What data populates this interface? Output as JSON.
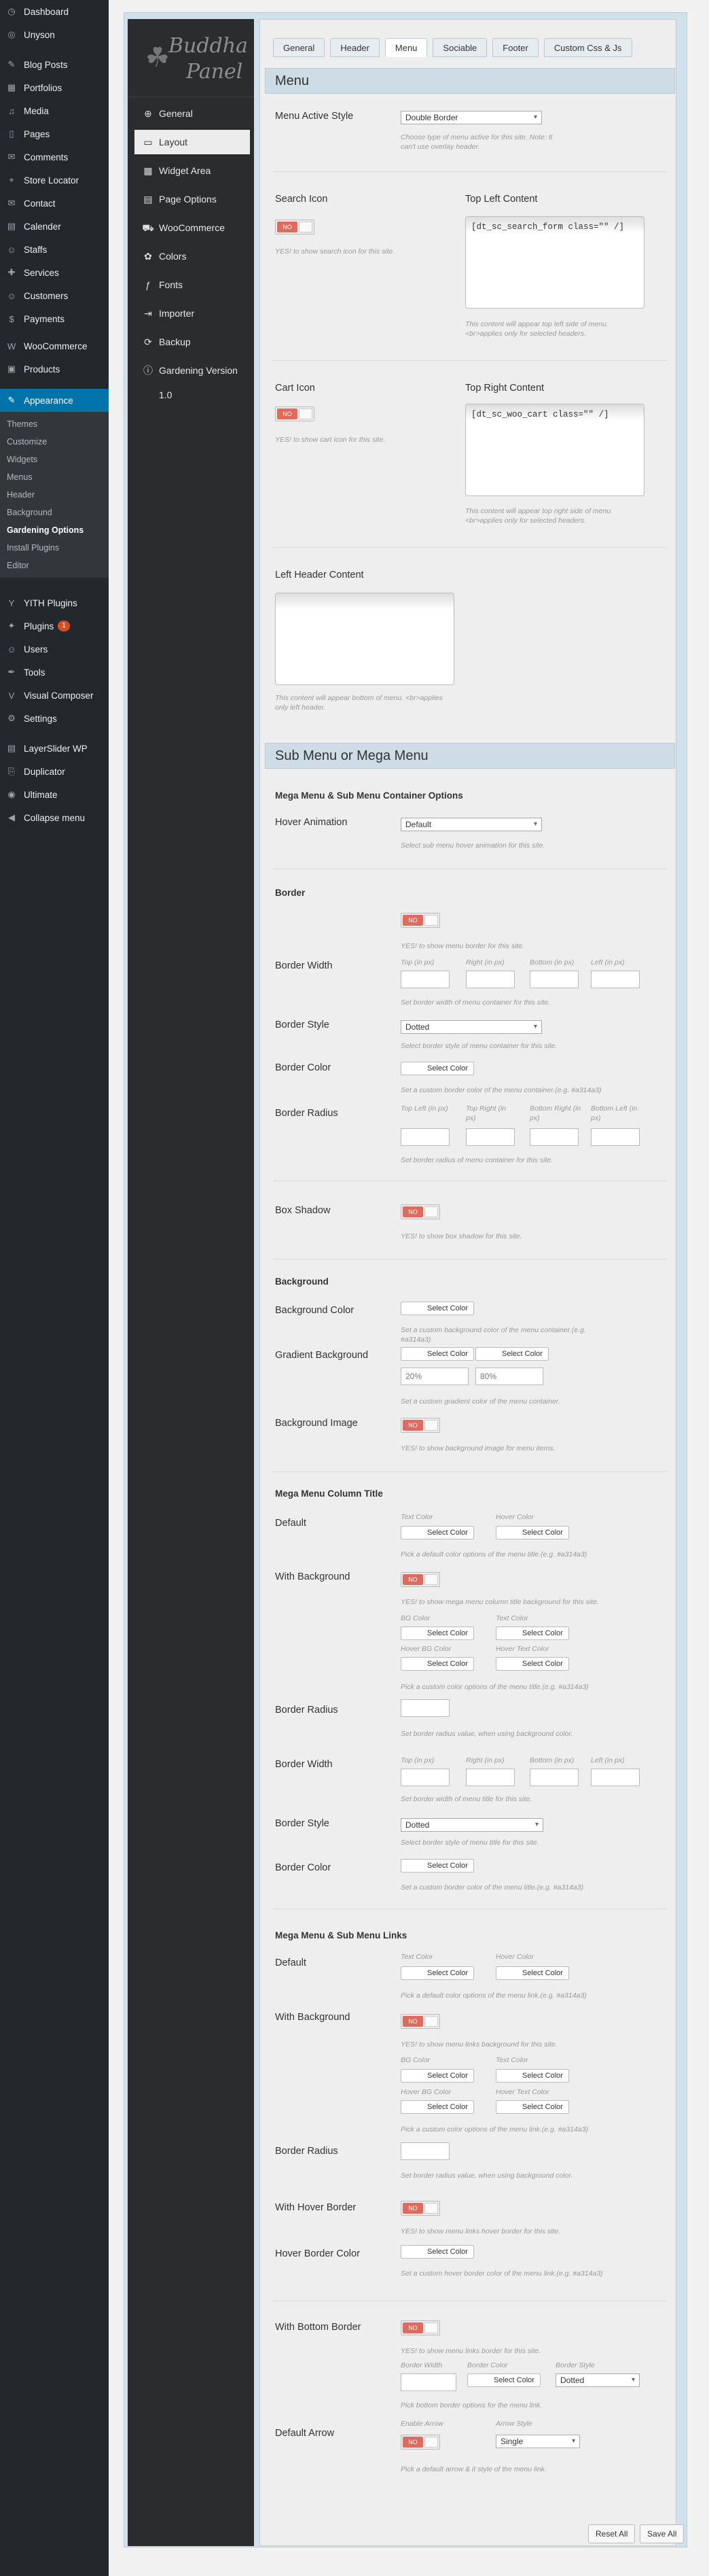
{
  "wp_menu": {
    "top": [
      {
        "icon": "dashboard-icon",
        "glyph": "◷",
        "label": "Dashboard"
      },
      {
        "icon": "wpml-icon",
        "glyph": "◎",
        "label": "Unyson"
      }
    ],
    "group2": [
      {
        "icon": "pin-icon",
        "glyph": "✎",
        "label": "Blog Posts"
      },
      {
        "icon": "portfolio-icon",
        "glyph": "▦",
        "label": "Portfolios"
      },
      {
        "icon": "media-icon",
        "glyph": "♫",
        "label": "Media"
      },
      {
        "icon": "pages-icon",
        "glyph": "▯",
        "label": "Pages"
      },
      {
        "icon": "comments-icon",
        "glyph": "✉",
        "label": "Comments"
      },
      {
        "icon": "location-icon",
        "glyph": "⌖",
        "label": "Store Locator"
      },
      {
        "icon": "contact-icon",
        "glyph": "✉",
        "label": "Contact"
      },
      {
        "icon": "calendar-icon",
        "glyph": "▤",
        "label": "Calender"
      },
      {
        "icon": "staff-icon",
        "glyph": "☺",
        "label": "Staffs"
      },
      {
        "icon": "services-icon",
        "glyph": "✚",
        "label": "Services"
      },
      {
        "icon": "customers-icon",
        "glyph": "☺",
        "label": "Customers"
      },
      {
        "icon": "payments-icon",
        "glyph": "$",
        "label": "Payments"
      }
    ],
    "group3": [
      {
        "icon": "woo-icon",
        "glyph": "W",
        "label": "WooCommerce"
      },
      {
        "icon": "products-icon",
        "glyph": "▣",
        "label": "Products"
      }
    ],
    "appearance": {
      "icon": "brush-icon",
      "glyph": "✎",
      "label": "Appearance"
    },
    "appearance_sub": [
      "Themes",
      "Customize",
      "Widgets",
      "Menus",
      "Header",
      "Background",
      "Gardening Options",
      "Install Plugins",
      "Editor"
    ],
    "appearance_active": "Gardening Options",
    "group4": [
      {
        "icon": "yith-icon",
        "glyph": "Y",
        "label": "YITH Plugins"
      },
      {
        "icon": "plugins-icon",
        "glyph": "✦",
        "label": "Plugins",
        "badge": "1"
      },
      {
        "icon": "users-icon",
        "glyph": "☺",
        "label": "Users"
      },
      {
        "icon": "tools-icon",
        "glyph": "✒",
        "label": "Tools"
      },
      {
        "icon": "vc-icon",
        "glyph": "V",
        "label": "Visual Composer"
      },
      {
        "icon": "settings-icon",
        "glyph": "⚙",
        "label": "Settings"
      }
    ],
    "group5": [
      {
        "icon": "layerslider-icon",
        "glyph": "▤",
        "label": "LayerSlider WP"
      },
      {
        "icon": "duplicator-icon",
        "glyph": "⎘",
        "label": "Duplicator"
      },
      {
        "icon": "ultimate-icon",
        "glyph": "◉",
        "label": "Ultimate"
      },
      {
        "icon": "collapse-icon",
        "glyph": "◀",
        "label": "Collapse menu"
      }
    ]
  },
  "brand": {
    "line1": "Buddha",
    "line2": "Panel"
  },
  "panel_nav": [
    {
      "icon": "globe-icon",
      "glyph": "⊕",
      "label": "General"
    },
    {
      "icon": "layout-icon",
      "glyph": "▭",
      "label": "Layout",
      "active": true
    },
    {
      "icon": "widget-icon",
      "glyph": "▦",
      "label": "Widget Area"
    },
    {
      "icon": "page-icon",
      "glyph": "▤",
      "label": "Page Options"
    },
    {
      "icon": "cart-icon",
      "glyph": "⛟",
      "label": "WooCommerce"
    },
    {
      "icon": "palette-icon",
      "glyph": "✿",
      "label": "Colors"
    },
    {
      "icon": "font-icon",
      "glyph": "ƒ",
      "label": "Fonts"
    },
    {
      "icon": "import-icon",
      "glyph": "⇥",
      "label": "Importer"
    },
    {
      "icon": "backup-icon",
      "glyph": "⟳",
      "label": "Backup"
    },
    {
      "icon": "info-icon",
      "glyph": "ⓘ",
      "label": "Gardening Version 1.0"
    }
  ],
  "tabs": [
    "General",
    "Header",
    "Menu",
    "Sociable",
    "Footer",
    "Custom Css & Js"
  ],
  "active_tab": "Menu",
  "yes_no": "NO",
  "select_color": "Select Color",
  "menu": {
    "title": "Menu",
    "active_style_label": "Menu Active Style",
    "active_style_value": "Double Border",
    "active_style_hint": "Choose type of menu active for this site. Note: It can't use overlay header.",
    "search_label": "Search Icon",
    "search_hint": "YES! to show search icon for this site.",
    "top_left_label": "Top Left Content",
    "top_left_value": "[dt_sc_search_form class=\"\" /]",
    "top_left_hint": "This content will appear top left side of menu. <br>applies only for selected headers.",
    "cart_label": "Cart Icon",
    "cart_hint": "YES! to show cart icon for this site.",
    "top_right_label": "Top Right Content",
    "top_right_value": "[dt_sc_woo_cart class=\"\" /]",
    "top_right_hint": "This content will appear top right side of menu. <br>applies only for selected headers.",
    "left_header_label": "Left Header Content",
    "left_header_hint": "This content will appear bottom of menu. <br>applies only left header."
  },
  "sub": {
    "title": "Sub Menu or Mega Menu",
    "container_heading": "Mega Menu & Sub Menu Container Options",
    "hover_anim_label": "Hover Animation",
    "hover_anim_value": "Default",
    "hover_anim_hint": "Select sub menu hover animation for this site.",
    "border_heading": "Border",
    "border_toggle_hint": "YES! to show menu border for this site.",
    "border_width_label": "Border Width",
    "border_width_subs": [
      "Top (in px)",
      "Right (in px)",
      "Bottom (in px)",
      "Left (in px)"
    ],
    "border_width_hint": "Set border width of menu container for this site.",
    "border_style_label": "Border Style",
    "border_style_value": "Dotted",
    "border_style_hint": "Select border style of menu container for this site.",
    "border_color_label": "Border Color",
    "border_color_hint": "Set a custom border color of the menu container.(e.g. #a314a3)",
    "border_radius_label": "Border Radius",
    "border_radius_subs": [
      "Top Left (in px)",
      "Top Right (in px)",
      "Bottom Right (in px)",
      "Bottom Left (in px)"
    ],
    "border_radius_hint": "Set border radius of menu container for this site.",
    "box_shadow_label": "Box Shadow",
    "box_shadow_hint": "YES! to show box shadow for this site.",
    "bg_heading": "Background",
    "bg_color_label": "Background Color",
    "bg_color_hint": "Set a custom background color of the menu container.(e.g. #a314a3)",
    "gradient_label": "Gradient Background",
    "gradient_p1": "20%",
    "gradient_p2": "80%",
    "gradient_hint": "Set a custom gradient color of the menu container.",
    "bg_image_label": "Background Image",
    "bg_image_hint": "YES! to show background image for menu items.",
    "col_heading": "Mega Menu Column Title",
    "col_default_label": "Default",
    "text_color": "Text Color",
    "hover_color": "Hover Color",
    "col_default_hint": "Pick a default color options of the menu title.(e.g. #a314a3)",
    "col_with_bg_label": "With Background",
    "col_with_bg_hint": "YES! to show mega menu column title background for this site.",
    "bg_color_sub": "BG Color",
    "hover_bg_color": "Hover BG Color",
    "hover_text_color": "Hover Text Color",
    "col_custom_hint": "Pick a custom color options of the menu title.(e.g. #a314a3)",
    "col_radius_label": "Border Radius",
    "col_radius_hint": "Set border radius value, when using background color.",
    "col_bwidth_label": "Border Width",
    "col_bwidth_hint": "Set border width of menu title for this site.",
    "col_bstyle_label": "Border Style",
    "col_bstyle_value": "Dotted",
    "col_bstyle_hint": "Select border style of menu title for this site.",
    "col_bcolor_label": "Border Color",
    "col_bcolor_hint": "Set a custom border color of the menu title.(e.g. #a314a3)",
    "links_heading": "Mega Menu & Sub Menu Links",
    "links_default_label": "Default",
    "links_default_hint": "Pick a default color options of the menu link.(e.g. #a314a3)",
    "links_with_bg_label": "With Background",
    "links_with_bg_hint": "YES! to show menu links background for this site.",
    "links_custom_hint": "Pick a custom color options of the menu link.(e.g. #a314a3)",
    "links_radius_label": "Border Radius",
    "links_radius_hint": "Set border radius value, when using background color.",
    "links_hover_border_label": "With Hover Border",
    "links_hover_border_hint": "YES! to show menu links hover border for this site.",
    "links_hover_bcolor_label": "Hover Border Color",
    "links_hover_bcolor_hint": "Set a custom hover border color of the menu link.(e.g. #a314a3)",
    "links_bottom_border_label": "With Bottom Border",
    "links_bottom_border_hint": "YES! to show menu links border for this site.",
    "bb_width": "Border Width",
    "bb_color": "Border Color",
    "bb_style": "Border Style",
    "bb_style_value": "Dotted",
    "bb_hint": "Pick bottom border options for the menu link.",
    "arrow_label": "Default Arrow",
    "enable_arrow": "Enable Arrow",
    "arrow_style": "Arrow Style",
    "arrow_style_value": "Single",
    "arrow_hint": "Pick a default arrow & it style of the menu link."
  },
  "buttons": {
    "reset": "Reset All",
    "save": "Save All"
  },
  "colors": {
    "accent": "#0073aa",
    "toggle_no": "#e06b5c",
    "header_bg": "#cedde5",
    "panel_dark": "#2b2c2e"
  }
}
